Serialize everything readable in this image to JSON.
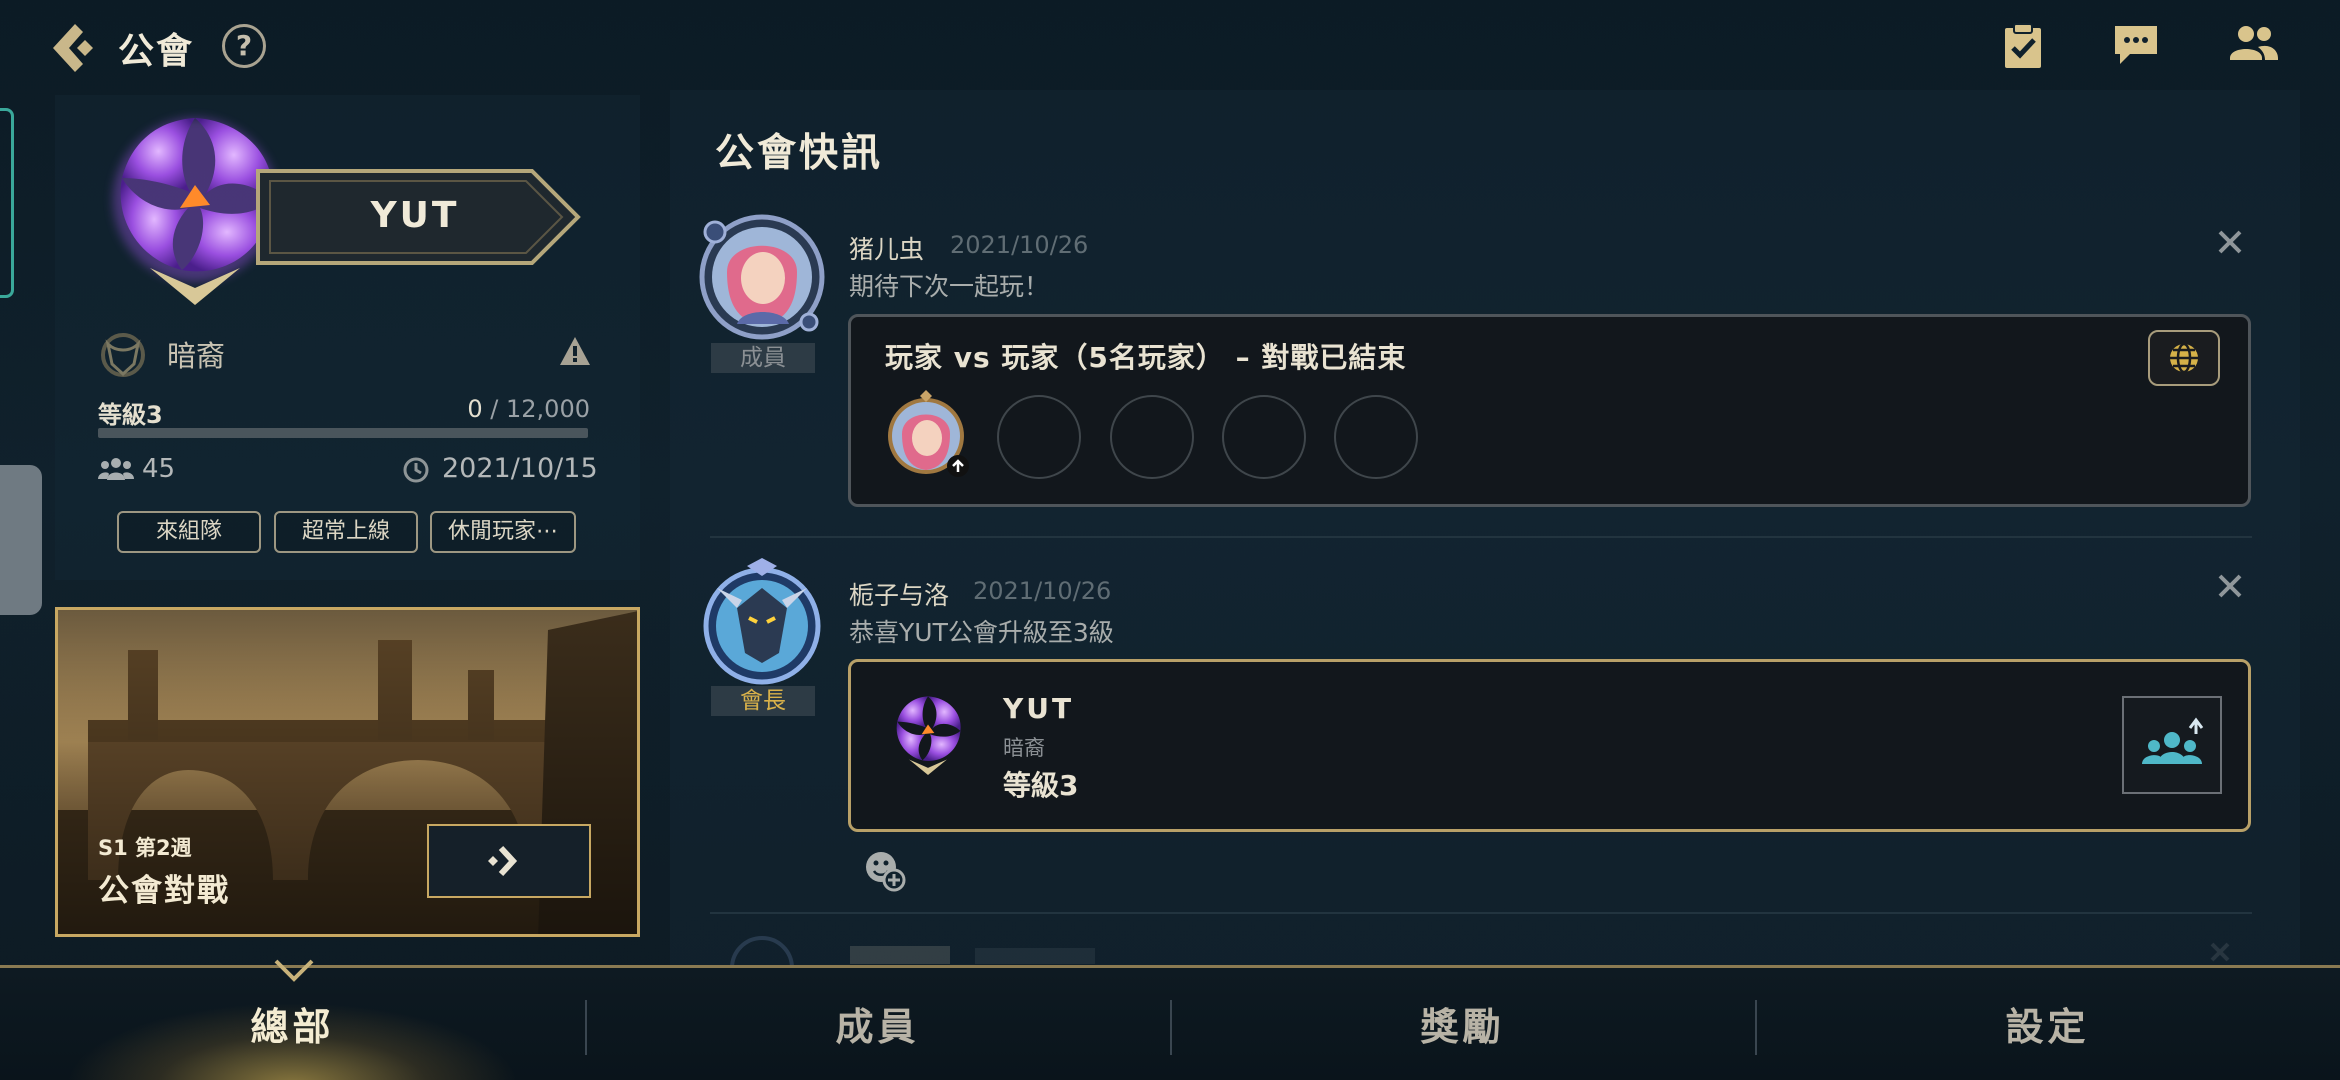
{
  "header": {
    "title": "公會",
    "back_icon": "chevron-left-icon",
    "help_label": "?",
    "icons": [
      "clipboard-check-icon",
      "chat-icon",
      "friends-icon"
    ]
  },
  "guild": {
    "name": "YUT",
    "leader": "暗裔",
    "level_label": "等級3",
    "xp_current": "0",
    "xp_max": " / 12,000",
    "xp_progress": 0,
    "member_count": "45",
    "created_date": "2021/10/15",
    "tags": [
      "來組隊",
      "超常上線",
      "休閒玩家⋯"
    ]
  },
  "clash_banner": {
    "week": "S1 第2週",
    "title": "公會對戰"
  },
  "feed": {
    "title": "公會快訊",
    "posts": [
      {
        "author": "猪儿虫",
        "date": "2021/10/26",
        "text": "期待下次一起玩！",
        "role": "成員",
        "match_title": "玩家 vs 玩家（5名玩家） – 對戰已結束"
      },
      {
        "author": "栀子与洛",
        "date": "2021/10/26",
        "text": "恭喜YUT公會升級至3級",
        "role": "會長",
        "card_name": "YUT",
        "card_leader": "暗裔",
        "card_level": "等級3"
      }
    ]
  },
  "nav": {
    "tabs": [
      "總部",
      "成員",
      "獎勵",
      "設定"
    ],
    "active": 0
  },
  "colors": {
    "accent_gold": "#c8a862",
    "teal": "#3aa89a",
    "background": "#0c1b25",
    "member_role": "#8b9094",
    "leader_role": "#d9b24a"
  }
}
